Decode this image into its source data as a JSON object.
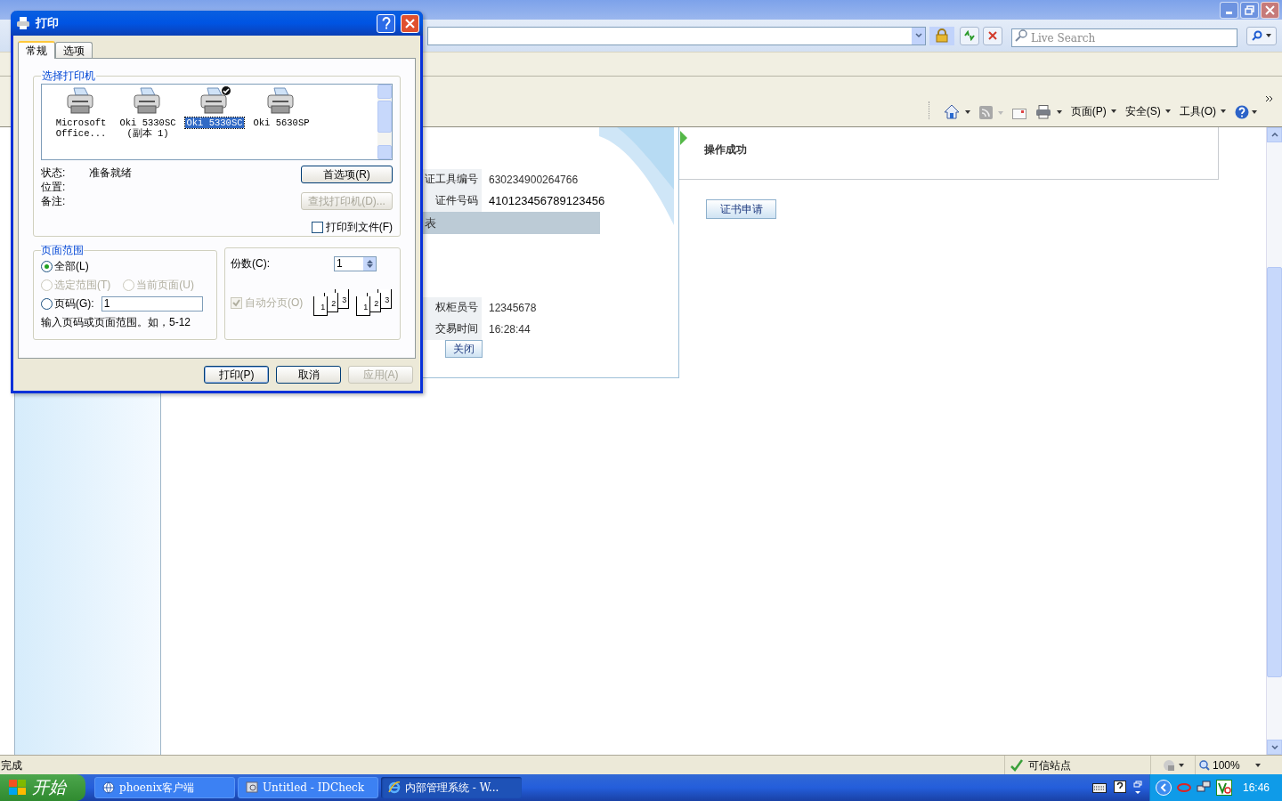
{
  "search": {
    "placeholder": "Live Search"
  },
  "command_menus": [
    "页面(P)",
    "安全(S)",
    "工具(O)"
  ],
  "result_panel": {
    "rows": [
      {
        "label": "证工具编号",
        "value": "630234900264766",
        "strong": false
      },
      {
        "label": "证件号码",
        "value": "410123456789123456",
        "strong": true
      }
    ],
    "section": "表",
    "rows2": [
      {
        "label": "权柜员号",
        "value": "12345678",
        "strong": false
      },
      {
        "label": "交易时间",
        "value": "16:28:44",
        "strong": false
      }
    ],
    "close_button": "关闭"
  },
  "status_message": "操作成功",
  "apply_button": "证书申请",
  "status_bar": {
    "text": "完成",
    "zone": "可信站点",
    "zoom": "100%"
  },
  "taskbar": {
    "start": "开始",
    "tasks": [
      {
        "label": "phoenix客户端",
        "selected": false,
        "kind": "globe"
      },
      {
        "label": "Untitled - IDCheck",
        "selected": false,
        "kind": "app"
      },
      {
        "label": "内部管理系统 - W...",
        "selected": true,
        "kind": "ie"
      }
    ],
    "clock": "16:46"
  },
  "dialog": {
    "title": "打印",
    "tabs": [
      {
        "label": "常规",
        "selected": true
      },
      {
        "label": "选项",
        "selected": false
      }
    ],
    "printer_group": {
      "title": "选择打印机",
      "printers": [
        {
          "name": "Microsoft Office...",
          "selected": false,
          "default": false
        },
        {
          "name": "Oki 5330SC (副本 1)",
          "selected": false,
          "default": false
        },
        {
          "name": "Oki 5330SC",
          "selected": true,
          "default": true
        },
        {
          "name": "Oki 5630SP",
          "selected": false,
          "default": false
        }
      ]
    },
    "info": [
      {
        "label": "状态:",
        "value": "准备就绪"
      },
      {
        "label": "位置:"
      },
      {
        "label": "备注:"
      }
    ],
    "preferences_button": {
      "label": "首选项(R)",
      "disabled": false
    },
    "find_button": {
      "label": "查找打印机(D)...",
      "disabled": true
    },
    "print_to_file": {
      "label": "打印到文件(F)",
      "checked": false
    },
    "page_range": {
      "title": "页面范围",
      "options": [
        {
          "label": "全部(L)",
          "selected": true,
          "disabled": false
        },
        {
          "label": "选定范围(T)",
          "selected": false,
          "disabled": true
        },
        {
          "label": "当前页面(U)",
          "selected": false,
          "disabled": true
        },
        {
          "label": "页码(G):",
          "selected": false,
          "disabled": false
        }
      ],
      "pages_value": "1",
      "hint": "输入页码或页面范围。如，5-12"
    },
    "copies": {
      "label": "份数(C):",
      "value": "1"
    },
    "collate": {
      "label": "自动分页(O)",
      "checked": true,
      "disabled": true
    },
    "collate_stacks": [
      [
        "1",
        "2",
        "3"
      ],
      [
        "1",
        "2",
        "3"
      ]
    ],
    "buttons": [
      {
        "label": "打印(P)",
        "disabled": false,
        "default": true
      },
      {
        "label": "取消",
        "disabled": false,
        "default": false
      },
      {
        "label": "应用(A)",
        "disabled": true,
        "default": false
      }
    ]
  }
}
